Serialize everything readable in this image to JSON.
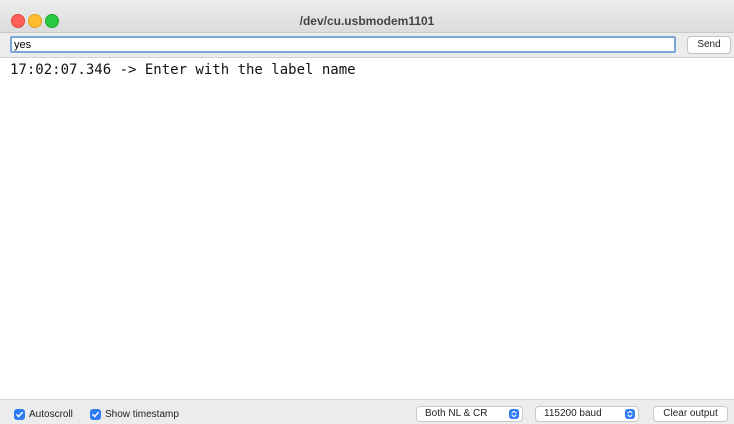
{
  "window": {
    "title": "/dev/cu.usbmodem1101"
  },
  "send": {
    "input_value": "yes",
    "button_label": "Send"
  },
  "output": {
    "lines": [
      "17:02:07.346 -> Enter with the label name"
    ]
  },
  "footer": {
    "autoscroll_label": "Autoscroll",
    "autoscroll_checked": true,
    "timestamp_label": "Show timestamp",
    "timestamp_checked": true,
    "line_ending": "Both NL & CR",
    "baud_rate": "115200 baud",
    "clear_label": "Clear output"
  },
  "colors": {
    "accent": "#2d7cf6",
    "close": "#ff5f57",
    "minimize": "#febc2e",
    "zoom": "#28c840"
  }
}
